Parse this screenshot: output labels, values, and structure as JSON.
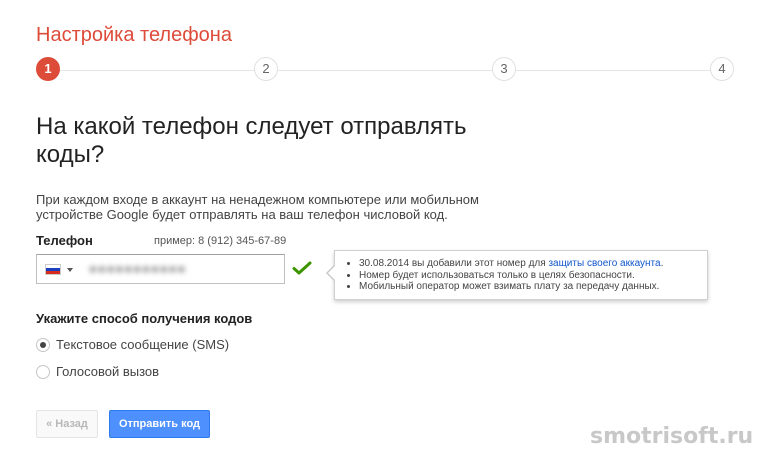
{
  "header": {
    "title": "Настройка телефона"
  },
  "stepper": {
    "steps": [
      "1",
      "2",
      "3",
      "4"
    ],
    "current": 1
  },
  "main": {
    "heading": "На какой телефон следует отправлять коды?",
    "description": "При каждом входе в аккаунт на ненадежном компьютере или мобильном устройстве Google будет отправлять на ваш телефон числовой код."
  },
  "phone": {
    "label": "Телефон",
    "example": "пример: 8 (912) 345-67-89",
    "value": "●●●●●●●●●●●",
    "country_flag": "russia-flag-icon",
    "status_icon": "checkmark-icon",
    "status_color": "#3d9400"
  },
  "tooltip": {
    "line1_prefix": "30.08.2014 вы добавили этот номер для ",
    "line1_link": "защиты своего аккаунта",
    "line1_suffix": ".",
    "line2": "Номер будет использоваться только в целях безопасности.",
    "line3": "Мобильный оператор может взимать плату за передачу данных."
  },
  "method": {
    "heading": "Укажите способ получения кодов",
    "options": [
      {
        "label": "Текстовое сообщение (SMS)",
        "selected": true
      },
      {
        "label": "Голосовой вызов",
        "selected": false
      }
    ]
  },
  "buttons": {
    "back": "« Назад",
    "send": "Отправить код"
  },
  "colors": {
    "accent_red": "#dd4b39",
    "primary_blue": "#4d90fe",
    "link": "#1155cc"
  },
  "watermark": "smotrisoft.ru"
}
